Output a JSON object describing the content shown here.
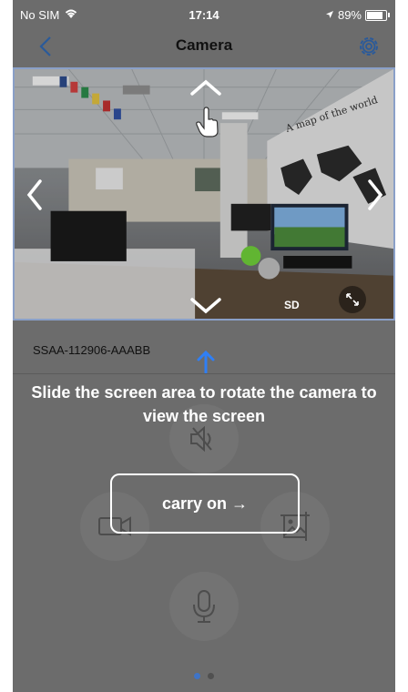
{
  "status_bar": {
    "carrier": "No SIM",
    "time": "17:14",
    "battery": "89%"
  },
  "nav": {
    "title": "Camera"
  },
  "video": {
    "quality_badge": "SD"
  },
  "device": {
    "id": "SSAA-112906-AAABB"
  },
  "guide": {
    "text": "Slide the screen area to rotate the camera to view the screen",
    "button_label": "carry on →"
  },
  "controls": [
    "speaker-mute-icon",
    "record-video-icon",
    "snapshot-icon",
    "microphone-icon"
  ],
  "pagination": {
    "pages": 2,
    "current": 1
  },
  "colors": {
    "accent": "#2f7ff5",
    "overlay_bg": "#6c6c6c",
    "video_border": "#8aa0c8"
  }
}
